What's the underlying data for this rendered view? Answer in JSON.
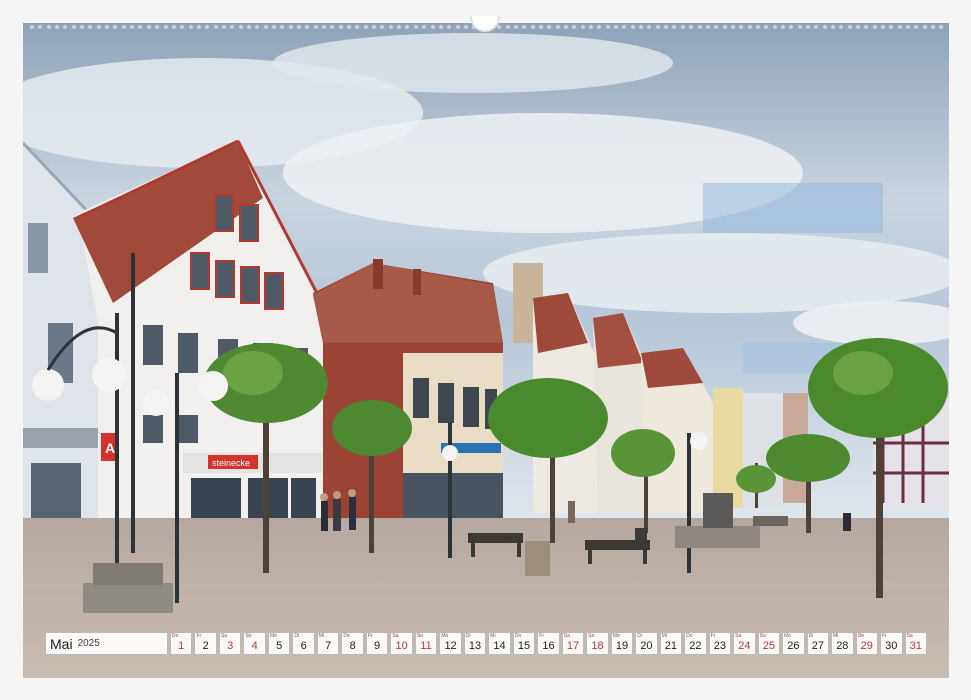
{
  "calendar": {
    "month": "Mai",
    "year": "2025",
    "days": [
      {
        "n": "1",
        "dow": "Do",
        "red": true
      },
      {
        "n": "2",
        "dow": "Fr",
        "red": false
      },
      {
        "n": "3",
        "dow": "Sa",
        "red": true
      },
      {
        "n": "4",
        "dow": "So",
        "red": true
      },
      {
        "n": "5",
        "dow": "Mo",
        "red": false
      },
      {
        "n": "6",
        "dow": "Di",
        "red": false
      },
      {
        "n": "7",
        "dow": "Mi",
        "red": false
      },
      {
        "n": "8",
        "dow": "Do",
        "red": false
      },
      {
        "n": "9",
        "dow": "Fr",
        "red": false
      },
      {
        "n": "10",
        "dow": "Sa",
        "red": true
      },
      {
        "n": "11",
        "dow": "So",
        "red": true
      },
      {
        "n": "12",
        "dow": "Mo",
        "red": false
      },
      {
        "n": "13",
        "dow": "Di",
        "red": false
      },
      {
        "n": "14",
        "dow": "Mi",
        "red": false
      },
      {
        "n": "15",
        "dow": "Do",
        "red": false
      },
      {
        "n": "16",
        "dow": "Fr",
        "red": false
      },
      {
        "n": "17",
        "dow": "Sa",
        "red": true
      },
      {
        "n": "18",
        "dow": "So",
        "red": true
      },
      {
        "n": "19",
        "dow": "Mo",
        "red": false
      },
      {
        "n": "20",
        "dow": "Di",
        "red": false
      },
      {
        "n": "21",
        "dow": "Mi",
        "red": false
      },
      {
        "n": "22",
        "dow": "Do",
        "red": false
      },
      {
        "n": "23",
        "dow": "Fr",
        "red": false
      },
      {
        "n": "24",
        "dow": "Sa",
        "red": true
      },
      {
        "n": "25",
        "dow": "So",
        "red": true
      },
      {
        "n": "26",
        "dow": "Mo",
        "red": false
      },
      {
        "n": "27",
        "dow": "Di",
        "red": false
      },
      {
        "n": "28",
        "dow": "Mi",
        "red": false
      },
      {
        "n": "29",
        "dow": "Do",
        "red": true
      },
      {
        "n": "30",
        "dow": "Fr",
        "red": false
      },
      {
        "n": "31",
        "dow": "Sa",
        "red": true
      }
    ]
  },
  "scene": {
    "shop_sign": "steinecke",
    "pharmacy_sign": "A"
  }
}
